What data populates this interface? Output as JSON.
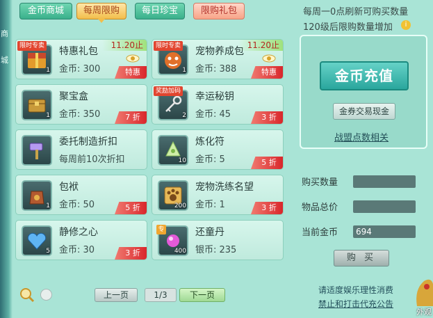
{
  "left_deco": {
    "chars": [
      "商",
      "城"
    ]
  },
  "tabs": [
    {
      "label": "金币商城",
      "active": false
    },
    {
      "label": "每周限购",
      "active": true
    },
    {
      "label": "每日珍宝",
      "active": false
    },
    {
      "label": "限购礼包",
      "active": false
    }
  ],
  "items": [
    {
      "name": "特惠礼包",
      "price": "金币: 300",
      "discount": "特惠",
      "deadline": "11.20止",
      "ribbon": "限时专卖",
      "qty": "1",
      "icon": "gift-chest-icon"
    },
    {
      "name": "宠物养成包",
      "price": "金币: 388",
      "discount": "特惠",
      "deadline": "11.20止",
      "ribbon": "限时专卖",
      "qty": "1",
      "icon": "pet-pack-icon"
    },
    {
      "name": "聚宝盒",
      "price": "金币: 350",
      "discount": "7 折",
      "qty": "1",
      "icon": "treasure-box-icon"
    },
    {
      "name": "幸运秘钥",
      "price": "金币: 45",
      "discount": "3 折",
      "ribbon": "奖励加码",
      "qty": "2",
      "icon": "key-icon"
    },
    {
      "name": "委托制造折扣",
      "price": "每周前10次折扣",
      "icon": "hammer-icon"
    },
    {
      "name": "炼化符",
      "price": "金币: 5",
      "discount": "5 折",
      "qty": "10",
      "icon": "talisman-icon"
    },
    {
      "name": "包袱",
      "price": "金币: 50",
      "discount": "5 折",
      "qty": "1",
      "icon": "bag-icon"
    },
    {
      "name": "宠物洗练名望",
      "price": "金币: 1",
      "discount": "3 折",
      "qty": "200",
      "icon": "paw-badge-icon"
    },
    {
      "name": "静修之心",
      "price": "金币: 30",
      "discount": "3 折",
      "qty": "5",
      "icon": "heart-gem-icon"
    },
    {
      "name": "还童丹",
      "price": "银币: 235",
      "qty": "400",
      "badge": "专",
      "icon": "pill-icon"
    }
  ],
  "pager": {
    "prev": "上一页",
    "page": "1/3",
    "next": "下一页"
  },
  "right": {
    "notice1": "每周一0点刷新可购买数量",
    "notice2": "120级后限购数量增加",
    "charge": "金币充值",
    "exchange": "金券交易现金",
    "alliance": "战盟点数相关",
    "buy_qty_label": "购买数量",
    "total_label": "物品总价",
    "current_label": "当前金币",
    "buy_qty_value": "",
    "total_value": "",
    "current_value": "694",
    "buy": "购 买",
    "footer1": "请适度娱乐理性消费",
    "footer2": "禁止和打击代充公告",
    "appearance": "外观"
  }
}
